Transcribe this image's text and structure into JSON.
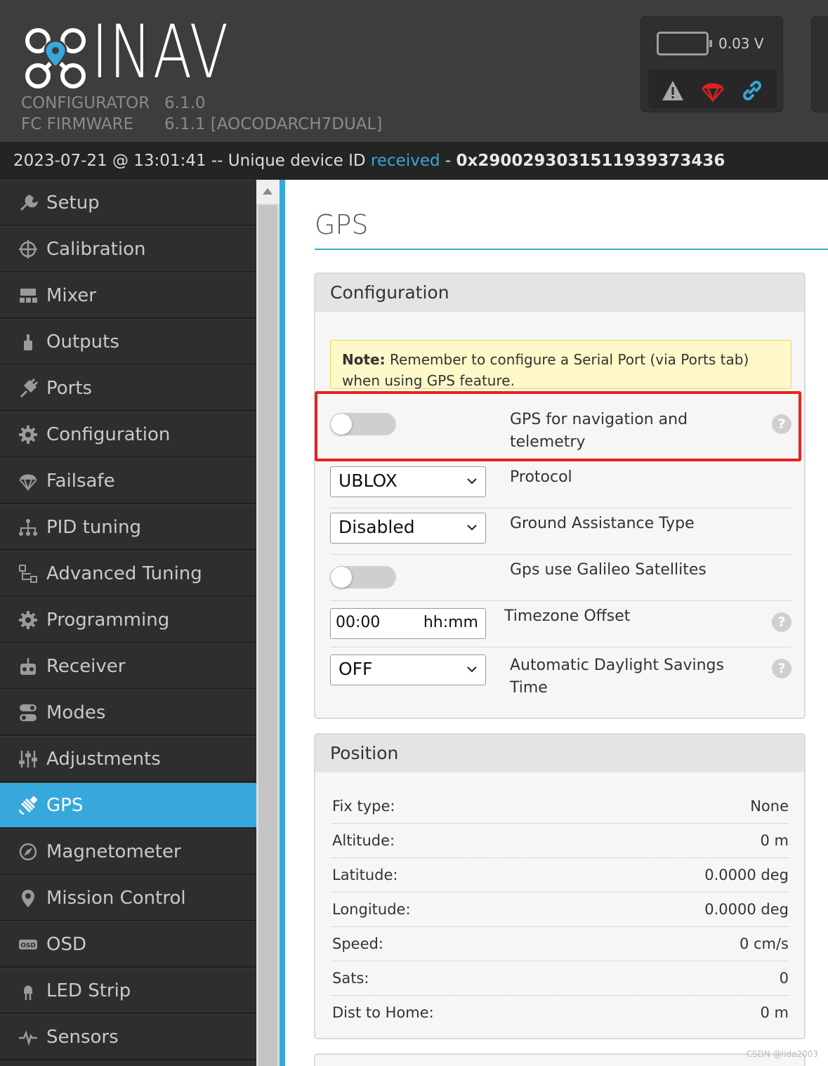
{
  "header": {
    "brand": "INAV",
    "configurator_label": "CONFIGURATOR",
    "configurator_version": "6.1.0",
    "firmware_label": "FC FIRMWARE",
    "firmware_version": "6.1.1 [AOCODARCH7DUAL]",
    "battery_voltage": "0.03 V"
  },
  "log": {
    "prefix": "2023-07-21 @ 13:01:41 -- Unique device ID ",
    "highlight": "received",
    "dash": " - ",
    "device_id": "0x290029303151193937343​6"
  },
  "sidebar": {
    "items": [
      {
        "label": "Setup",
        "icon": "wrench-icon"
      },
      {
        "label": "Calibration",
        "icon": "crosshair-icon"
      },
      {
        "label": "Mixer",
        "icon": "mixer-icon"
      },
      {
        "label": "Outputs",
        "icon": "motor-icon"
      },
      {
        "label": "Ports",
        "icon": "plug-icon"
      },
      {
        "label": "Configuration",
        "icon": "gear-icon"
      },
      {
        "label": "Failsafe",
        "icon": "parachute-icon"
      },
      {
        "label": "PID tuning",
        "icon": "tree-icon"
      },
      {
        "label": "Advanced Tuning",
        "icon": "advanced-tuning-icon"
      },
      {
        "label": "Programming",
        "icon": "gear-icon"
      },
      {
        "label": "Receiver",
        "icon": "receiver-icon"
      },
      {
        "label": "Modes",
        "icon": "switch-icon"
      },
      {
        "label": "Adjustments",
        "icon": "sliders-icon"
      },
      {
        "label": "GPS",
        "icon": "satellite-icon"
      },
      {
        "label": "Magnetometer",
        "icon": "compass-icon"
      },
      {
        "label": "Mission Control",
        "icon": "map-pin-icon"
      },
      {
        "label": "OSD",
        "icon": "osd-icon"
      },
      {
        "label": "LED Strip",
        "icon": "led-icon"
      },
      {
        "label": "Sensors",
        "icon": "pulse-icon"
      }
    ],
    "active": "GPS"
  },
  "page": {
    "title": "GPS"
  },
  "configuration": {
    "heading": "Configuration",
    "note_bold": "Note:",
    "note_text": " Remember to configure a Serial Port (via Ports tab) when using GPS feature.",
    "gps_toggle_label": "GPS for navigation and telemetry",
    "gps_toggle_on": false,
    "protocol_value": "UBLOX",
    "protocol_label": "Protocol",
    "ground_assist_value": "Disabled",
    "ground_assist_label": "Ground Assistance Type",
    "galileo_label": "Gps use Galileo Satellites",
    "galileo_on": false,
    "timezone_value": "00:00",
    "timezone_unit": "hh:mm",
    "timezone_label": "Timezone Offset",
    "dst_value": "OFF",
    "dst_label": "Automatic Daylight Savings Time",
    "help_glyph": "?"
  },
  "position": {
    "heading": "Position",
    "rows": [
      {
        "label": "Fix type:",
        "value": "None"
      },
      {
        "label": "Altitude:",
        "value": "0 m"
      },
      {
        "label": "Latitude:",
        "value": "0.0000 deg"
      },
      {
        "label": "Longitude:",
        "value": "0.0000 deg"
      },
      {
        "label": "Speed:",
        "value": "0 cm/s"
      },
      {
        "label": "Sats:",
        "value": "0"
      },
      {
        "label": "Dist to Home:",
        "value": "0 m"
      }
    ]
  },
  "watermark": "CSDN @lida2003",
  "colors": {
    "accent": "#37a8db",
    "highlight_box": "#e8231f",
    "note_bg": "#fff8c9"
  }
}
